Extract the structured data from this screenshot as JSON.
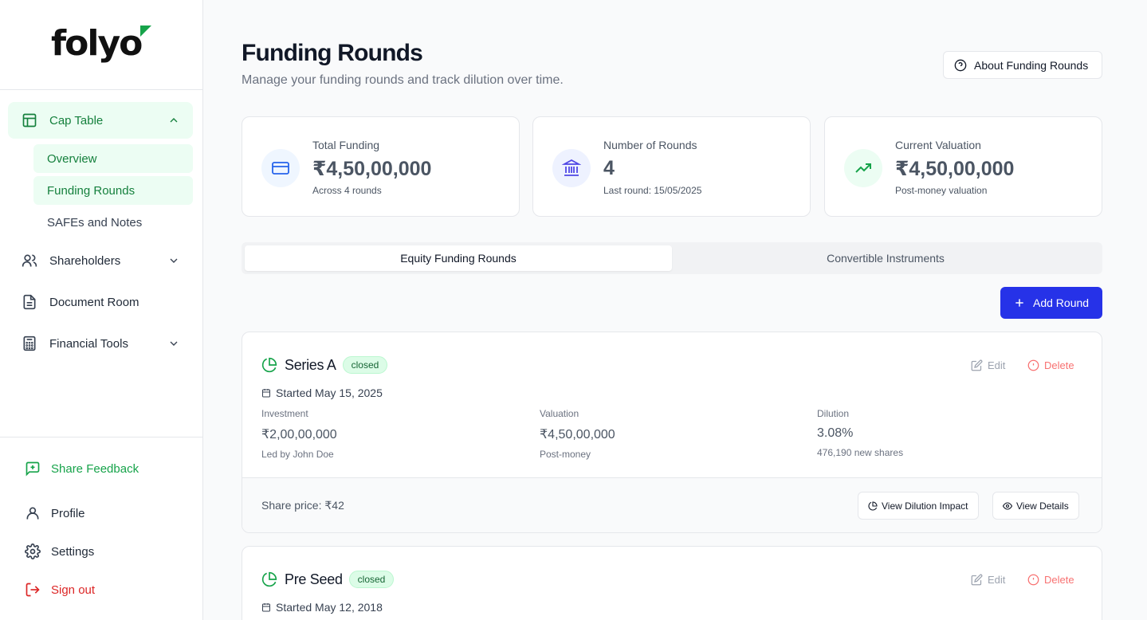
{
  "brand": {
    "name": "folyo"
  },
  "sidebar": {
    "cap_table": "Cap Table",
    "sub_items": [
      "Overview",
      "Funding Rounds",
      "SAFEs and Notes"
    ],
    "shareholders": "Shareholders",
    "document_room": "Document Room",
    "financial_tools": "Financial Tools",
    "share_feedback": "Share Feedback",
    "profile": "Profile",
    "settings": "Settings",
    "sign_out": "Sign out"
  },
  "header": {
    "title": "Funding Rounds",
    "subtitle": "Manage your funding rounds and track dilution over time.",
    "about_button": "About Funding Rounds"
  },
  "stats": [
    {
      "label": "Total Funding",
      "value": "₹4,50,00,000",
      "note": "Across 4 rounds",
      "icon": "credit-card-icon"
    },
    {
      "label": "Number of Rounds",
      "value": "4",
      "note": "Last round: 15/05/2025",
      "icon": "bank-icon"
    },
    {
      "label": "Current Valuation",
      "value": "₹4,50,00,000",
      "note": "Post-money valuation",
      "icon": "trending-up-icon"
    }
  ],
  "tabs": [
    "Equity Funding Rounds",
    "Convertible Instruments"
  ],
  "add_round_label": "Add Round",
  "actions": {
    "edit": "Edit",
    "delete": "Delete",
    "view_dilution": "View Dilution Impact",
    "view_details": "View Details"
  },
  "labels": {
    "investment": "Investment",
    "valuation": "Valuation",
    "dilution": "Dilution"
  },
  "rounds": [
    {
      "name": "Series A",
      "status": "closed",
      "started": "Started May 15, 2025",
      "investment": "₹2,00,00,000",
      "investment_note": "Led by John Doe",
      "valuation": "₹4,50,00,000",
      "valuation_note": "Post-money",
      "dilution": "3.08%",
      "dilution_note": "476,190 new shares",
      "share_price": "Share price: ₹42"
    },
    {
      "name": "Pre Seed",
      "status": "closed",
      "started": "Started May 12, 2018"
    }
  ],
  "colors": {
    "accent_green": "#16a34a",
    "primary_blue": "#2632e8",
    "danger_red": "#f87171"
  }
}
